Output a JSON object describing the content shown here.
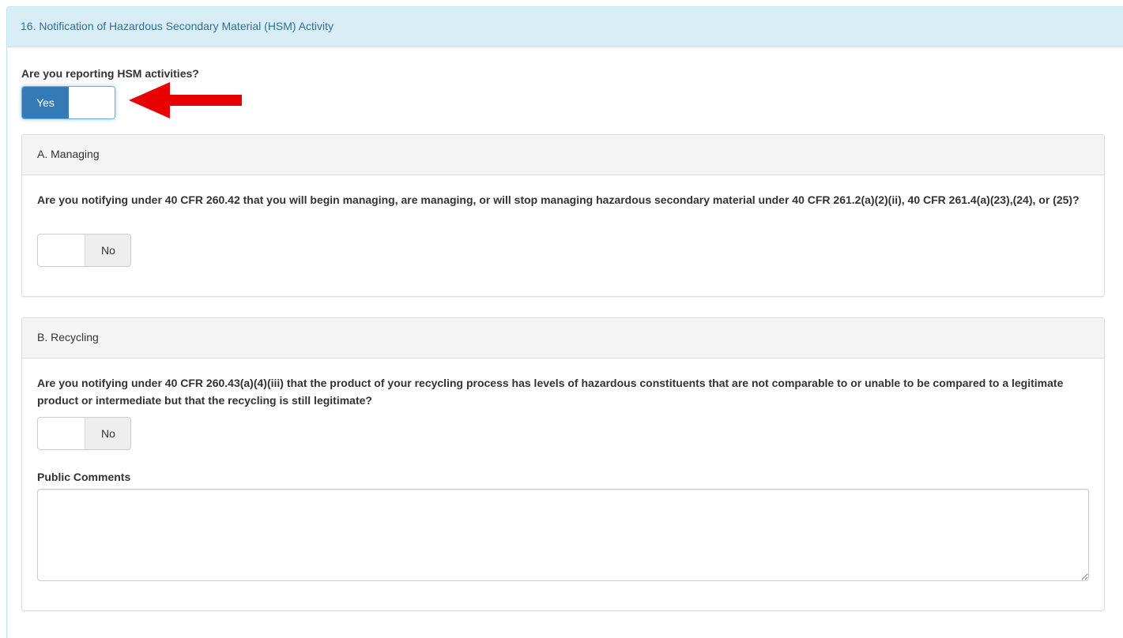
{
  "section": {
    "title": "16. Notification of Hazardous Secondary Material (HSM) Activity",
    "question": "Are you reporting HSM activities?",
    "toggle": {
      "label": "Yes",
      "state": "on"
    }
  },
  "managing": {
    "title": "A. Managing",
    "question": "Are you notifying under 40 CFR 260.42 that you will begin managing, are managing, or will stop managing hazardous secondary material under 40 CFR 261.2(a)(2)(ii), 40 CFR 261.4(a)(23),(24), or (25)?",
    "toggle": {
      "label": "No",
      "state": "off"
    }
  },
  "recycling": {
    "title": "B. Recycling",
    "question": "Are you notifying under 40 CFR 260.43(a)(4)(iii) that the product of your recycling process has levels of hazardous constituents that are not comparable to or unable to be compared to a legitimate product or intermediate but that the recycling is still legitimate?",
    "toggle": {
      "label": "No",
      "state": "off"
    },
    "comments_label": "Public Comments",
    "comments_value": ""
  },
  "colors": {
    "accent": "#337ab7",
    "info_heading_bg": "#d9edf7",
    "annotation_arrow": "#e60000"
  },
  "annotation": {
    "icon": "red-arrow-left-icon"
  }
}
